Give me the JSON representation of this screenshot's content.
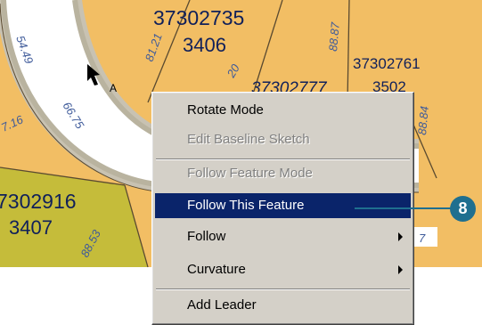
{
  "map": {
    "parcels": [
      {
        "id": "37302735",
        "num": "3406"
      },
      {
        "id": "37302761",
        "num": "3502"
      },
      {
        "id": "37302777"
      },
      {
        "id": "7302916",
        "num": "3407"
      }
    ],
    "point_label": "A",
    "dimensions": [
      "54.49",
      "81.21",
      "20",
      "88.87",
      "66.75",
      "7.16",
      "88.84",
      "88.53"
    ],
    "edge_text": "7"
  },
  "context_menu": {
    "items": [
      {
        "label": "Rotate Mode",
        "disabled": false
      },
      {
        "label": "Edit Baseline Sketch",
        "disabled": true
      },
      {
        "label": "Follow Feature Mode",
        "disabled": true
      },
      {
        "label": "Follow This Feature",
        "disabled": false,
        "selected": true
      },
      {
        "label": "Follow",
        "disabled": false,
        "submenu": true
      },
      {
        "label": "Curvature",
        "disabled": false,
        "submenu": true
      },
      {
        "label": "Add Leader",
        "disabled": false
      }
    ]
  },
  "callout": {
    "number": "8"
  },
  "colors": {
    "parcel_orange": "#f2be64",
    "parcel_green": "#c5bc3a",
    "road_white": "#ffffff",
    "road_edge": "#c8c2b2",
    "boundary": "#5a4a30",
    "menu_bg": "#d4d0c8",
    "selection": "#0a246a",
    "callout": "#1f6f8f"
  }
}
